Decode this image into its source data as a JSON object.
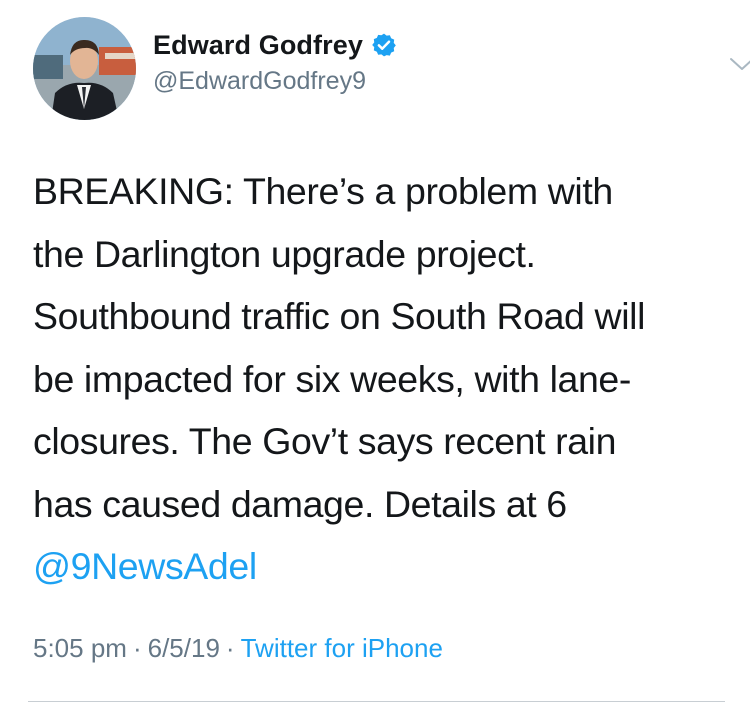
{
  "author": {
    "display_name": "Edward Godfrey",
    "handle": "@EdwardGodfrey9",
    "verified": true,
    "avatar": "avatar-photo"
  },
  "tweet": {
    "lines": [
      "BREAKING: There’s a problem with",
      "the Darlington upgrade project.",
      "Southbound traffic on South Road will",
      "be impacted for six weeks, with lane-",
      "closures. The Gov’t says recent rain",
      "has caused damage. Details at 6"
    ],
    "mention": "@9NewsAdel"
  },
  "meta": {
    "time": "5:05 pm",
    "separator": "·",
    "date": "6/5/19",
    "source": "Twitter for iPhone"
  },
  "icons": {
    "verified": "verified-badge-icon",
    "menu": "chevron-down-icon"
  },
  "colors": {
    "text": "#14171a",
    "secondary": "#657786",
    "link": "#1da1f2",
    "verified": "#1da1f2"
  }
}
